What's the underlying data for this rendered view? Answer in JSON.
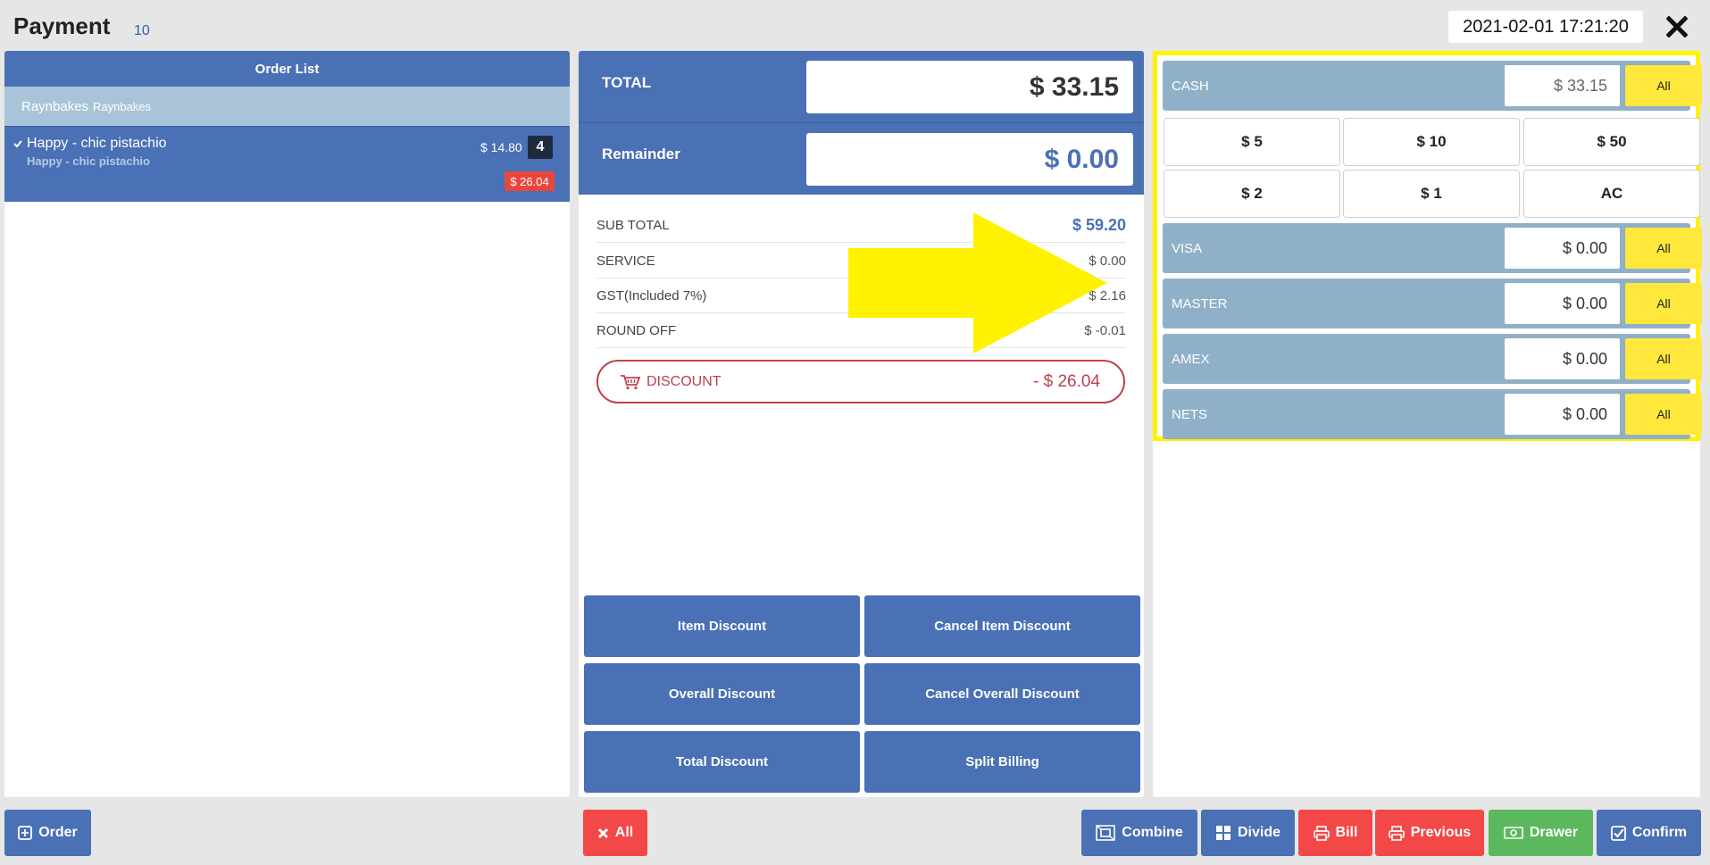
{
  "header": {
    "title": "Payment",
    "count": "10",
    "datetime": "2021-02-01 17:21:20"
  },
  "order_list": {
    "title": "Order List",
    "group": {
      "name": "Raynbakes",
      "sub": "Raynbakes"
    },
    "items": [
      {
        "name": "Happy - chic pistachio",
        "sub": "Happy - chic pistachio",
        "price": "$ 14.80",
        "qty": "4",
        "discount": "$ 26.04"
      }
    ]
  },
  "totals": {
    "total_label": "TOTAL",
    "total_value": "$ 33.15",
    "remainder_label": "Remainder",
    "remainder_value": "$ 0.00"
  },
  "summary": [
    {
      "label": "SUB TOTAL",
      "value": "$ 59.20"
    },
    {
      "label": "SERVICE",
      "value": "$ 0.00"
    },
    {
      "label": "GST(Included 7%)",
      "value": "$ 2.16"
    },
    {
      "label": "ROUND OFF",
      "value": "$ -0.01"
    }
  ],
  "discount": {
    "label": "DISCOUNT",
    "value": "- $ 26.04"
  },
  "discount_buttons": {
    "item": "Item Discount",
    "cancel_item": "Cancel Item Discount",
    "overall": "Overall Discount",
    "cancel_overall": "Cancel Overall Discount",
    "total": "Total Discount",
    "split": "Split Billing"
  },
  "payments": {
    "cash": {
      "name": "CASH",
      "amount": "$ 33.15",
      "all": "All"
    },
    "quick": [
      "$ 5",
      "$ 10",
      "$ 50",
      "$ 2",
      "$ 1",
      "AC"
    ],
    "visa": {
      "name": "VISA",
      "amount": "$ 0.00",
      "all": "All"
    },
    "master": {
      "name": "MASTER",
      "amount": "$ 0.00",
      "all": "All"
    },
    "amex": {
      "name": "AMEX",
      "amount": "$ 0.00",
      "all": "All"
    },
    "nets": {
      "name": "NETS",
      "amount": "$ 0.00",
      "all": "All"
    }
  },
  "bottom": {
    "order": "Order",
    "all": "All",
    "combine": "Combine",
    "divide": "Divide",
    "bill": "Bill",
    "previous": "Previous",
    "drawer": "Drawer",
    "confirm": "Confirm"
  },
  "colors": {
    "primary": "#4a70b5",
    "highlight": "#fff200",
    "danger": "#f24848",
    "success": "#5cb85c",
    "payment_row": "#90b0c7",
    "all_button": "#ffe83b"
  },
  "icons": [
    "close-icon",
    "check-icon",
    "cart-icon",
    "plus-square-icon",
    "x-icon",
    "combine-icon",
    "grid-icon",
    "printer-icon",
    "money-icon",
    "check-square-icon"
  ]
}
